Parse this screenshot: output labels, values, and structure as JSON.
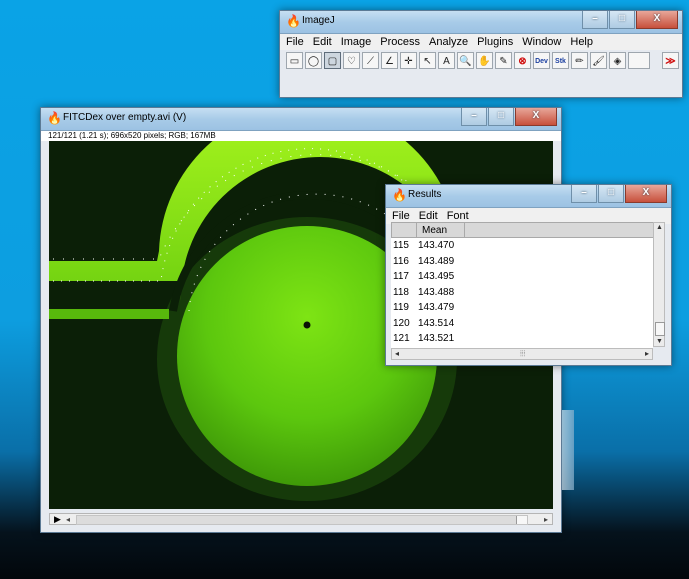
{
  "imagej": {
    "title": "ImageJ",
    "menu": [
      "File",
      "Edit",
      "Image",
      "Process",
      "Analyze",
      "Plugins",
      "Window",
      "Help"
    ],
    "tools": [
      {
        "name": "rectangle-tool-icon",
        "glyph": "▭"
      },
      {
        "name": "oval-tool-icon",
        "glyph": "◯"
      },
      {
        "name": "rounded-rect-tool-icon",
        "glyph": "▢"
      },
      {
        "name": "freehand-tool-icon",
        "glyph": "♡"
      },
      {
        "name": "line-tool-icon",
        "glyph": "⟋"
      },
      {
        "name": "angle-tool-icon",
        "glyph": "∠"
      },
      {
        "name": "point-tool-icon",
        "glyph": "✛"
      },
      {
        "name": "wand-tool-icon",
        "glyph": "↖"
      },
      {
        "name": "text-tool-icon",
        "glyph": "A"
      },
      {
        "name": "magnifier-tool-icon",
        "glyph": "🔍"
      },
      {
        "name": "hand-tool-icon",
        "glyph": "✋"
      },
      {
        "name": "dropper-tool-icon",
        "glyph": "✎"
      },
      {
        "name": "stop-tool-icon",
        "glyph": "⊗"
      },
      {
        "name": "dev-tool-icon",
        "glyph": "Dev"
      },
      {
        "name": "stk-tool-icon",
        "glyph": "Stk"
      },
      {
        "name": "pencil-tool-icon",
        "glyph": "✏"
      },
      {
        "name": "brush-tool-icon",
        "glyph": "🖌"
      },
      {
        "name": "flood-fill-tool-icon",
        "glyph": "◈"
      },
      {
        "name": "more-tools-icon",
        "glyph": "≫"
      }
    ]
  },
  "stack": {
    "title": "FITCDex over empty.avi (V)",
    "info": "121/121 (1.21 s); 696x520 pixels; RGB; 167MB"
  },
  "results": {
    "title": "Results",
    "menu": [
      "File",
      "Edit",
      "Font"
    ],
    "column": "Mean",
    "rows": [
      {
        "idx": "115",
        "mean": "143.470"
      },
      {
        "idx": "116",
        "mean": "143.489"
      },
      {
        "idx": "117",
        "mean": "143.495"
      },
      {
        "idx": "118",
        "mean": "143.488"
      },
      {
        "idx": "119",
        "mean": "143.479"
      },
      {
        "idx": "120",
        "mean": "143.514"
      },
      {
        "idx": "121",
        "mean": "143.521"
      }
    ]
  },
  "window_controls": {
    "minimize": "–",
    "maximize": "□",
    "close": "X"
  }
}
